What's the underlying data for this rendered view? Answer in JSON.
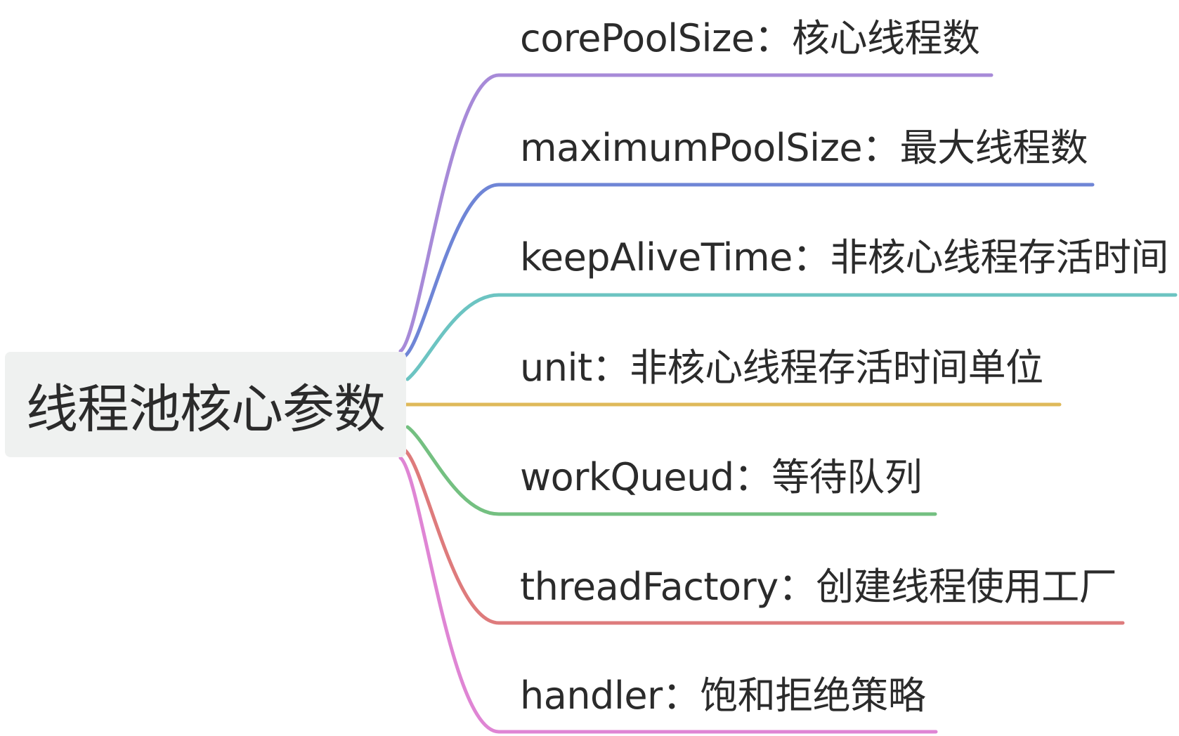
{
  "root": {
    "label": "线程池核心参数",
    "background": "#eff1f0"
  },
  "branches": [
    {
      "label": "corePoolSize：核心线程数",
      "color": "#a78ad8"
    },
    {
      "label": "maximumPoolSize：最大线程数",
      "color": "#6f85d6"
    },
    {
      "label": "keepAliveTime：非核心线程存活时间",
      "color": "#6cc4c2"
    },
    {
      "label": "unit：非核心线程存活时间单位",
      "color": "#dfb95a"
    },
    {
      "label": "workQueud：等待队列",
      "color": "#74c081"
    },
    {
      "label": "threadFactory：创建线程使用工厂",
      "color": "#de7b7c"
    },
    {
      "label": "handler：饱和拒绝策略",
      "color": "#df85d4"
    }
  ]
}
